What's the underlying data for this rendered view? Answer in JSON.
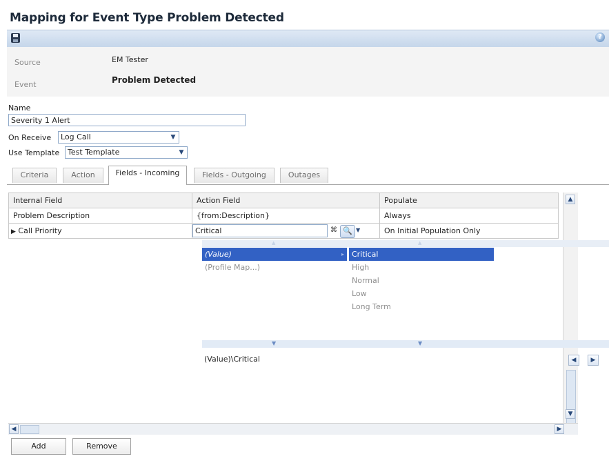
{
  "page": {
    "title": "Mapping for Event Type Problem Detected"
  },
  "toolbar": {
    "save_icon": "save-icon",
    "help_icon": "help-icon",
    "help_glyph": "?"
  },
  "info": {
    "source_label": "Source",
    "source_value": "EM Tester",
    "event_label": "Event",
    "event_value": "Problem Detected"
  },
  "form": {
    "name_label": "Name",
    "name_value": "Severity 1 Alert",
    "on_receive_label": "On Receive",
    "on_receive_value": "Log Call",
    "use_template_label": "Use Template",
    "use_template_value": "Test Template"
  },
  "tabs": [
    {
      "label": "Criteria",
      "active": false
    },
    {
      "label": "Action",
      "active": false
    },
    {
      "label": "Fields - Incoming",
      "active": true
    },
    {
      "label": "Fields - Outgoing",
      "active": false
    },
    {
      "label": "Outages",
      "active": false
    }
  ],
  "grid": {
    "columns": [
      "Internal Field",
      "Action Field",
      "Populate"
    ],
    "rows": [
      {
        "internal": "Problem Description",
        "action": "{from:Description}",
        "populate": "Always"
      },
      {
        "internal": "Call Priority",
        "action": "Critical",
        "populate": "On Initial Population Only"
      }
    ]
  },
  "picker": {
    "left_items": [
      "(Value)",
      "(Profile Map...)"
    ],
    "right_items": [
      "Critical",
      "High",
      "Normal",
      "Low",
      "Long Term"
    ],
    "result": "(Value)\\Critical"
  },
  "buttons": {
    "add": "Add",
    "remove": "Remove"
  },
  "colors": {
    "selection": "#3261c4",
    "toolbar": "#c5d6ea",
    "disabled_text": "#8f8f8f"
  }
}
